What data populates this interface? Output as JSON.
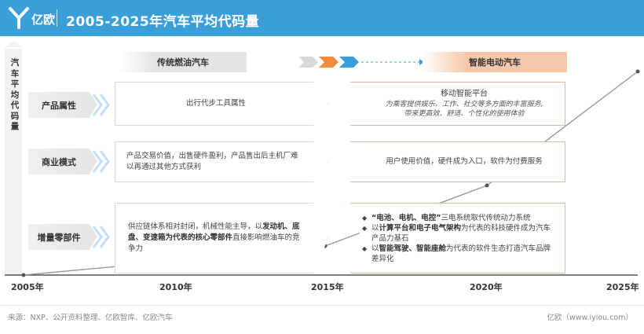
{
  "header": {
    "logo_text": "亿欧",
    "title": "2005-2025年汽车平均代码量"
  },
  "y_axis_label": "汽车平均代码量",
  "bands": {
    "left": "传统燃油汽车",
    "right": "智能电动汽车"
  },
  "rows": [
    {
      "label": "产品属性",
      "left_text": "出行代步工具属性",
      "right_title": "移动智能平台",
      "right_sub": [
        "为乘客提供娱乐、工作、社交等多方面的丰富服务,",
        "带来更高效、舒适、个性化的使用体验"
      ]
    },
    {
      "label": "商业模式",
      "left_lines": [
        "产品交易价值，出售硬件盈利，产品售出后主机厂难",
        "以再通过其他方式获利"
      ],
      "right_text": "用户使用价值，硬件成为入口，软件为付费服务"
    },
    {
      "label": "增量零部件",
      "left_parts": [
        {
          "t": "供应链体系相对封闭，机械性能主导，以",
          "b": false
        },
        {
          "t": "发动机、底",
          "b": true
        },
        {
          "t": "盘、变速箱为代表的核心零部件",
          "b": true
        },
        {
          "t": "直接影响燃油车的竞",
          "b": false
        },
        {
          "t": "争力",
          "b": false
        }
      ],
      "right_bullets": [
        [
          {
            "t": "“电池、电机、电控”",
            "b": true
          },
          {
            "t": "三电系统取代传统动力系统",
            "b": false
          }
        ],
        [
          {
            "t": "以",
            "b": false
          },
          {
            "t": "计算平台和电子电气架构",
            "b": true
          },
          {
            "t": "为代表的科技硬件成为汽车",
            "b": false
          }
        ],
        [
          {
            "t": "产品力基石",
            "b": false
          }
        ],
        [
          {
            "t": "以",
            "b": false
          },
          {
            "t": "智能驾驶、智能座舱",
            "b": true
          },
          {
            "t": "为代表的软件生态打造汽车品牌",
            "b": false
          }
        ],
        [
          {
            "t": "差异化",
            "b": false
          }
        ]
      ],
      "bullet_symbol": "◆"
    }
  ],
  "x_ticks": [
    "2005年",
    "2010年",
    "2015年",
    "2020年",
    "2025年"
  ],
  "footer": {
    "source": "来源：NXP、公开资料整理、亿欧智库、亿欧汽车",
    "credit": "亿欧（www.iyiou.com）"
  },
  "colors": {
    "header_bg": "#3a9fd8",
    "accent_orange": "#f08a3e",
    "chevron_blue": "#bfe0f2",
    "line_gray": "#888888"
  }
}
